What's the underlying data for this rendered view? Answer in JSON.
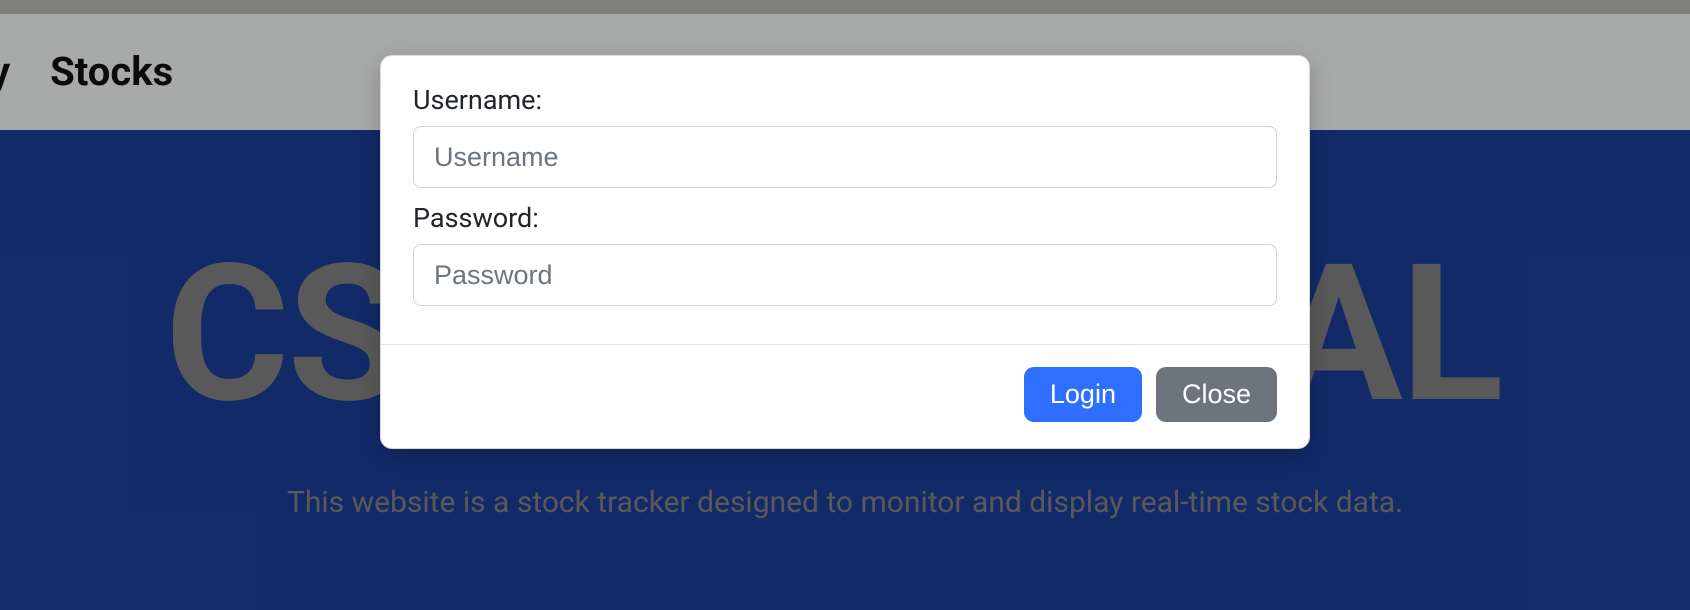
{
  "nav": {
    "partial_item": "y",
    "items": [
      "Stocks"
    ]
  },
  "hero": {
    "title_partial_left": "CS",
    "title_partial_right": "AL",
    "subtitle": "This website is a stock tracker designed to monitor and display real-time stock data."
  },
  "modal": {
    "username_label": "Username:",
    "username_placeholder": "Username",
    "username_value": "",
    "password_label": "Password:",
    "password_placeholder": "Password",
    "password_value": "",
    "login_label": "Login",
    "close_label": "Close"
  },
  "colors": {
    "hero_bg": "#1d3e9b",
    "primary": "#2f6fff",
    "secondary": "#6c757d",
    "muted_text": "#848484"
  }
}
